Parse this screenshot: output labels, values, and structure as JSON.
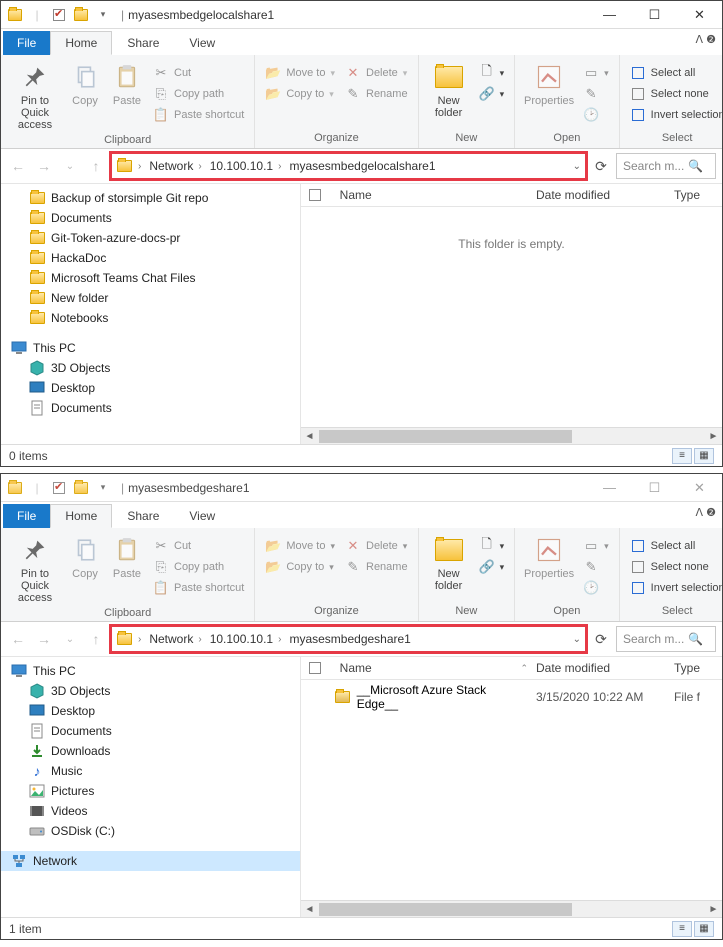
{
  "windows": [
    {
      "title": "myasesmbedgelocalshare1",
      "tabs": {
        "file": "File",
        "home": "Home",
        "share": "Share",
        "view": "View"
      },
      "ribbon": {
        "clipboard": {
          "label": "Clipboard",
          "pin": "Pin to Quick\naccess",
          "copy": "Copy",
          "paste": "Paste",
          "cut": "Cut",
          "copypath": "Copy path",
          "pasteshortcut": "Paste shortcut"
        },
        "organize": {
          "label": "Organize",
          "moveto": "Move to",
          "copyto": "Copy to",
          "delete": "Delete",
          "rename": "Rename"
        },
        "new": {
          "label": "New",
          "newfolder": "New\nfolder"
        },
        "open": {
          "label": "Open",
          "properties": "Properties"
        },
        "select": {
          "label": "Select",
          "selectall": "Select all",
          "selectnone": "Select none",
          "invert": "Invert selection"
        }
      },
      "breadcrumb": [
        "Network",
        "10.100.10.1",
        "myasesmbedgelocalshare1"
      ],
      "search_placeholder": "Search m...",
      "columns": {
        "name": "Name",
        "date": "Date modified",
        "type": "Type"
      },
      "tree": [
        {
          "label": "Backup of storsimple Git repo",
          "icon": "folder",
          "level": 1
        },
        {
          "label": "Documents",
          "icon": "folder",
          "level": 1
        },
        {
          "label": "Git-Token-azure-docs-pr",
          "icon": "folder",
          "level": 1
        },
        {
          "label": "HackaDoc",
          "icon": "folder",
          "level": 1
        },
        {
          "label": "Microsoft Teams Chat Files",
          "icon": "folder",
          "level": 1
        },
        {
          "label": "New folder",
          "icon": "folder",
          "level": 1
        },
        {
          "label": "Notebooks",
          "icon": "folder",
          "level": 1
        },
        {
          "label": "This PC",
          "icon": "pc",
          "level": 0,
          "spaced": true
        },
        {
          "label": "3D Objects",
          "icon": "3d",
          "level": 1
        },
        {
          "label": "Desktop",
          "icon": "desktop",
          "level": 1
        },
        {
          "label": "Documents",
          "icon": "docs",
          "level": 1
        }
      ],
      "empty_text": "This folder is empty.",
      "status": "0 items"
    },
    {
      "title": "myasesmbedgeshare1",
      "tabs": {
        "file": "File",
        "home": "Home",
        "share": "Share",
        "view": "View"
      },
      "ribbon": {
        "clipboard": {
          "label": "Clipboard",
          "pin": "Pin to Quick\naccess",
          "copy": "Copy",
          "paste": "Paste",
          "cut": "Cut",
          "copypath": "Copy path",
          "pasteshortcut": "Paste shortcut"
        },
        "organize": {
          "label": "Organize",
          "moveto": "Move to",
          "copyto": "Copy to",
          "delete": "Delete",
          "rename": "Rename"
        },
        "new": {
          "label": "New",
          "newfolder": "New\nfolder"
        },
        "open": {
          "label": "Open",
          "properties": "Properties"
        },
        "select": {
          "label": "Select",
          "selectall": "Select all",
          "selectnone": "Select none",
          "invert": "Invert selection"
        }
      },
      "breadcrumb": [
        "Network",
        "10.100.10.1",
        "myasesmbedgeshare1"
      ],
      "search_placeholder": "Search m...",
      "columns": {
        "name": "Name",
        "date": "Date modified",
        "type": "Type"
      },
      "tree": [
        {
          "label": "This PC",
          "icon": "pc",
          "level": 0
        },
        {
          "label": "3D Objects",
          "icon": "3d",
          "level": 1
        },
        {
          "label": "Desktop",
          "icon": "desktop",
          "level": 1
        },
        {
          "label": "Documents",
          "icon": "docs",
          "level": 1
        },
        {
          "label": "Downloads",
          "icon": "downloads",
          "level": 1
        },
        {
          "label": "Music",
          "icon": "music",
          "level": 1
        },
        {
          "label": "Pictures",
          "icon": "pictures",
          "level": 1
        },
        {
          "label": "Videos",
          "icon": "videos",
          "level": 1
        },
        {
          "label": "OSDisk (C:)",
          "icon": "disk",
          "level": 1
        },
        {
          "label": "Network",
          "icon": "network",
          "level": 0,
          "spaced": true,
          "selected": true
        }
      ],
      "files": [
        {
          "name": "__Microsoft Azure Stack Edge__",
          "date": "3/15/2020 10:22 AM",
          "type": "File f"
        }
      ],
      "status": "1 item"
    }
  ]
}
